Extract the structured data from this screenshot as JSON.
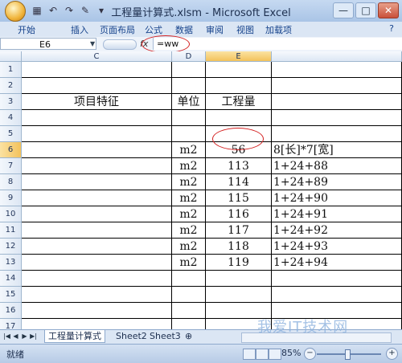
{
  "window": {
    "title": "工程量计算式.xlsm - Microsoft Excel",
    "controls": {
      "minimize": "—",
      "maximize": "□",
      "close": "✕"
    }
  },
  "quick_access": {
    "icons": [
      "excel-logo-icon",
      "undo-icon",
      "redo-icon",
      "paint-icon",
      "dropdown-icon"
    ]
  },
  "ribbon": {
    "tabs": [
      "开始",
      "插入",
      "页面布局",
      "公式",
      "数据",
      "审阅",
      "视图",
      "加载项"
    ],
    "help": "?"
  },
  "formula_bar": {
    "name_box": "E6",
    "fx_label": "fx",
    "content": "=ww"
  },
  "grid": {
    "columns": [
      "C",
      "D",
      "E"
    ],
    "selected_column": "E",
    "selected_row": "6",
    "rows": [
      {
        "num": "1",
        "C": "",
        "D": "",
        "E": "",
        "F": ""
      },
      {
        "num": "2",
        "C": "",
        "D": "",
        "E": "",
        "F": ""
      },
      {
        "num": "3",
        "C": "项目特征",
        "D": "单位",
        "E": "工程量",
        "F": ""
      },
      {
        "num": "4",
        "C": "",
        "D": "",
        "E": "",
        "F": ""
      },
      {
        "num": "5",
        "C": "",
        "D": "",
        "E": "",
        "F": ""
      },
      {
        "num": "6",
        "C": "",
        "D": "m2",
        "E": "56",
        "F": "8[长]*7[宽]"
      },
      {
        "num": "7",
        "C": "",
        "D": "m2",
        "E": "113",
        "F": "1+24+88"
      },
      {
        "num": "8",
        "C": "",
        "D": "m2",
        "E": "114",
        "F": "1+24+89"
      },
      {
        "num": "9",
        "C": "",
        "D": "m2",
        "E": "115",
        "F": "1+24+90"
      },
      {
        "num": "10",
        "C": "",
        "D": "m2",
        "E": "116",
        "F": "1+24+91"
      },
      {
        "num": "11",
        "C": "",
        "D": "m2",
        "E": "117",
        "F": "1+24+92"
      },
      {
        "num": "12",
        "C": "",
        "D": "m2",
        "E": "118",
        "F": "1+24+93"
      },
      {
        "num": "13",
        "C": "",
        "D": "m2",
        "E": "119",
        "F": "1+24+94"
      },
      {
        "num": "14",
        "C": "",
        "D": "",
        "E": "",
        "F": ""
      },
      {
        "num": "15",
        "C": "",
        "D": "",
        "E": "",
        "F": ""
      },
      {
        "num": "16",
        "C": "",
        "D": "",
        "E": "",
        "F": ""
      },
      {
        "num": "17",
        "C": "",
        "D": "",
        "E": "",
        "F": ""
      }
    ]
  },
  "sheets": {
    "active": "工程量计算式",
    "others": [
      "Sheet2",
      "Sheet3"
    ]
  },
  "status": {
    "ready": "就绪",
    "zoom": "85%"
  },
  "watermark": "我爱IT技术网"
}
